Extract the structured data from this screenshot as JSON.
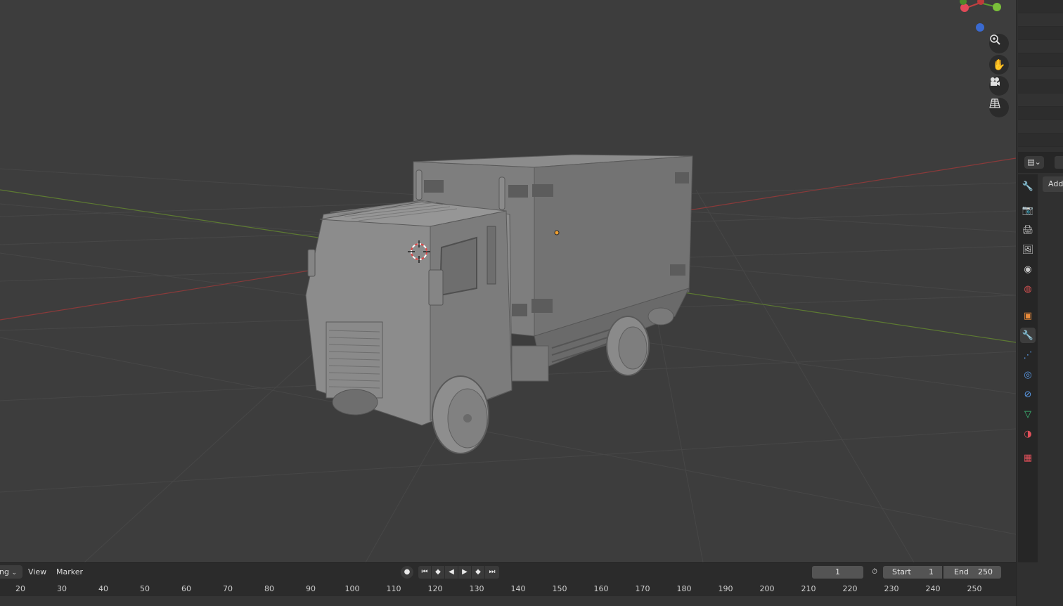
{
  "viewport": {
    "nav_icons": [
      "zoom-icon",
      "hand-pan-icon",
      "camera-icon",
      "grid-projection-icon"
    ]
  },
  "properties": {
    "editor_type_glyph": "▤⌄",
    "add_label": "Add",
    "tabs": [
      {
        "name": "tool-icon",
        "glyph": "🔧",
        "color": "#c8c8c8"
      },
      {
        "name": "render-icon",
        "glyph": "📷",
        "color": "#c8c8c8"
      },
      {
        "name": "output-icon",
        "glyph": "🖨",
        "color": "#c8c8c8"
      },
      {
        "name": "view-layer-icon",
        "glyph": "🖼",
        "color": "#c8c8c8"
      },
      {
        "name": "scene-icon",
        "glyph": "◉",
        "color": "#c8c8c8"
      },
      {
        "name": "world-icon",
        "glyph": "◍",
        "color": "#d05050"
      },
      {
        "name": "object-icon",
        "glyph": "▣",
        "color": "#e88a3a"
      },
      {
        "name": "modifier-icon",
        "glyph": "🔧",
        "color": "#5a9ae8"
      },
      {
        "name": "particles-icon",
        "glyph": "⋰",
        "color": "#5a9ae8"
      },
      {
        "name": "physics-icon",
        "glyph": "◎",
        "color": "#5a9ae8"
      },
      {
        "name": "constraints-icon",
        "glyph": "⊘",
        "color": "#5a9ae8"
      },
      {
        "name": "data-icon",
        "glyph": "▽",
        "color": "#3ec27a"
      },
      {
        "name": "material-icon",
        "glyph": "◑",
        "color": "#e0505a"
      },
      {
        "name": "texture-icon",
        "glyph": "▦",
        "color": "#e0505a"
      }
    ]
  },
  "timeline": {
    "mode_label": "ing",
    "view_label": "View",
    "marker_label": "Marker",
    "current_frame": "1",
    "start_label": "Start",
    "start_value": "1",
    "end_label": "End",
    "end_value": "250",
    "ruler_ticks": [
      "20",
      "30",
      "40",
      "50",
      "60",
      "70",
      "80",
      "90",
      "100",
      "110",
      "120",
      "130",
      "140",
      "150",
      "160",
      "170",
      "180",
      "190",
      "200",
      "210",
      "220",
      "230",
      "240",
      "250"
    ]
  }
}
